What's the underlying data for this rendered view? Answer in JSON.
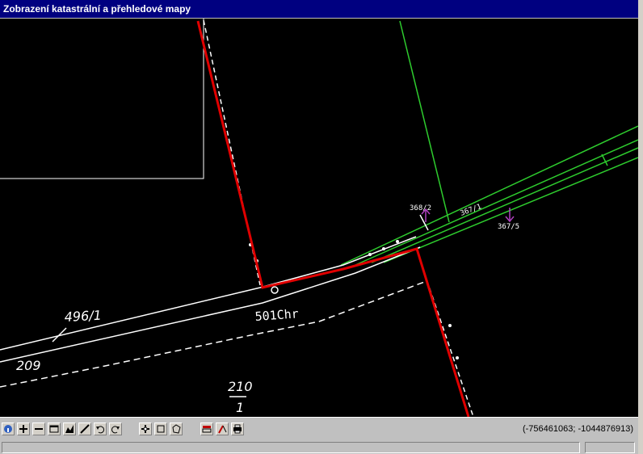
{
  "window": {
    "title": "Zobrazení katastrální a přehledové mapy"
  },
  "map": {
    "parcel_labels": [
      "496/1",
      "209",
      "501Chr",
      "210",
      "1",
      "368/2",
      "367/1",
      "367/5"
    ],
    "colors": {
      "background": "#000000",
      "parcel_line": "#ffffff",
      "highlight_boundary": "#e00000",
      "overview_line": "#2ecc2e",
      "pointer": "#b040c0"
    }
  },
  "toolbar": {
    "icons": [
      "info-icon",
      "zoom-in-icon",
      "zoom-out-icon",
      "zoom-window-icon",
      "zoom-extent-icon",
      "measure-icon",
      "undo-icon",
      "redo-icon",
      "pan-icon",
      "select-rect-icon",
      "select-polygon-icon",
      "layers-icon",
      "tool-icon",
      "print-icon"
    ],
    "coordinates": "(-756461063; -1044876913)"
  }
}
